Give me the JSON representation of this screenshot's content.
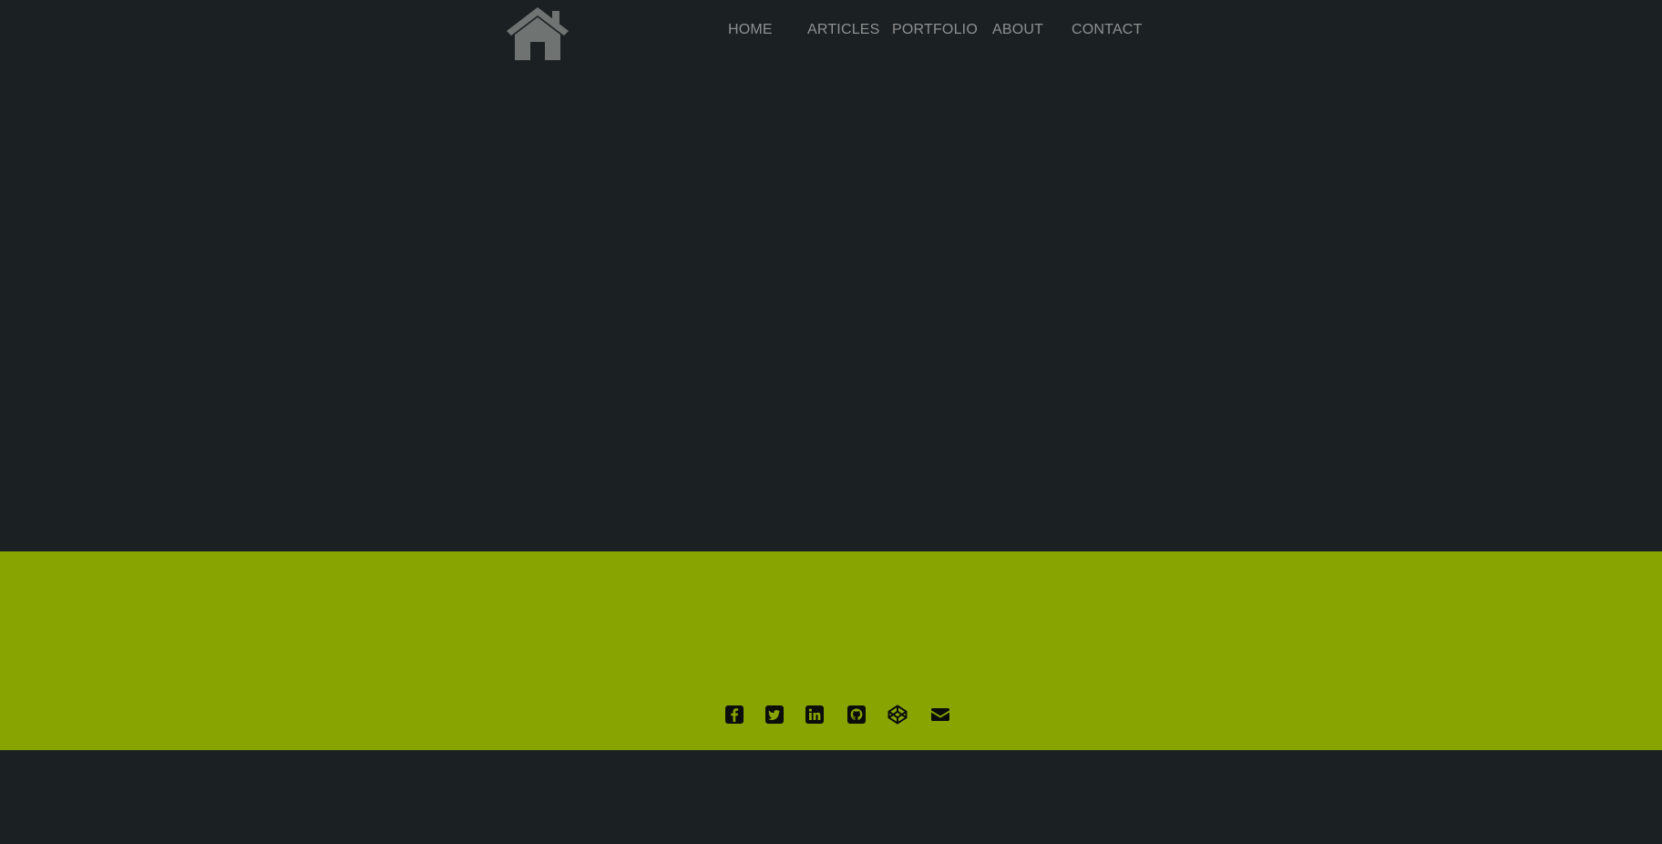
{
  "nav": {
    "home": "HOME",
    "articles": "ARTICLES",
    "portfolio": "PORTFOLIO",
    "about": "ABOUT",
    "contact": "CONTACT"
  },
  "logo": {
    "icon": "house-icon"
  },
  "social": [
    {
      "name": "facebook",
      "icon": "facebook-square-icon"
    },
    {
      "name": "twitter",
      "icon": "twitter-square-icon"
    },
    {
      "name": "linkedin",
      "icon": "linkedin-square-icon"
    },
    {
      "name": "github",
      "icon": "github-square-icon"
    },
    {
      "name": "codepen",
      "icon": "codepen-icon"
    },
    {
      "name": "email",
      "icon": "envelope-icon"
    }
  ],
  "colors": {
    "background": "#1b2122",
    "accent": "#87a400",
    "nav_text": "#8e9090",
    "logo": "#6f7473",
    "social_icons": "#0a0d08"
  }
}
